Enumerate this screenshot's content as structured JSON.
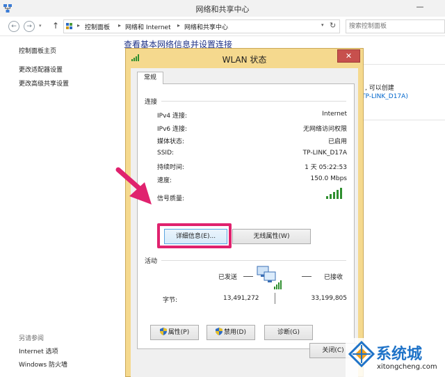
{
  "window": {
    "title": "网络和共享中心",
    "minimize": "—"
  },
  "address": {
    "back": "←",
    "forward": "→",
    "up": "↑",
    "crumbs": [
      "控制面板",
      "网络和 Internet",
      "网络和共享中心"
    ],
    "separator": "▸",
    "dropdown": "▾",
    "refresh": "↻",
    "search_placeholder": "搜索控制面板"
  },
  "leftnav": {
    "items": [
      "控制面板主页",
      "更改适配器设置",
      "更改高级共享设置"
    ],
    "see_also_label": "另请参阅",
    "see_also_items": [
      "Internet 选项",
      "Windows 防火墙"
    ]
  },
  "main": {
    "heading": "查看基本网络信息并设置连接",
    "partial_text": ", 可以创建",
    "partial_link": "TP-LINK_D17A)"
  },
  "dialog": {
    "title": "WLAN 状态",
    "close": "✕",
    "tab": "常规",
    "connection_group": "连接",
    "rows": [
      {
        "label": "IPv4 连接:",
        "value": "Internet"
      },
      {
        "label": "IPv6 连接:",
        "value": "无网络访问权限"
      },
      {
        "label": "媒体状态:",
        "value": "已启用"
      },
      {
        "label": "SSID:",
        "value": "TP-LINK_D17A"
      },
      {
        "label": "持续时间:",
        "value": "1 天 05:22:53"
      },
      {
        "label": "速度:",
        "value": "150.0 Mbps"
      }
    ],
    "signal_label": "信号质量:",
    "signal_quality": 1.0,
    "details_button": "详细信息(E)...",
    "wireless_button": "无线属性(W)",
    "activity_group": "活动",
    "sent_label": "已发送",
    "received_label": "已接收",
    "bytes_label": "字节:",
    "bytes_sent": "13,491,272",
    "bytes_received": "33,199,805",
    "properties_button": "属性(P)",
    "disable_button": "禁用(D)",
    "diagnose_button": "诊断(G)",
    "close_button": "关闭(C)"
  },
  "watermark": {
    "brand_cn": "系统城",
    "brand_en": "xitongcheng.com"
  },
  "colors": {
    "highlight": "#e0226e",
    "dialog_frame": "#f5d98e",
    "close_red": "#c7504d",
    "signal_green": "#2f8f2f",
    "link_blue": "#1e3287"
  }
}
